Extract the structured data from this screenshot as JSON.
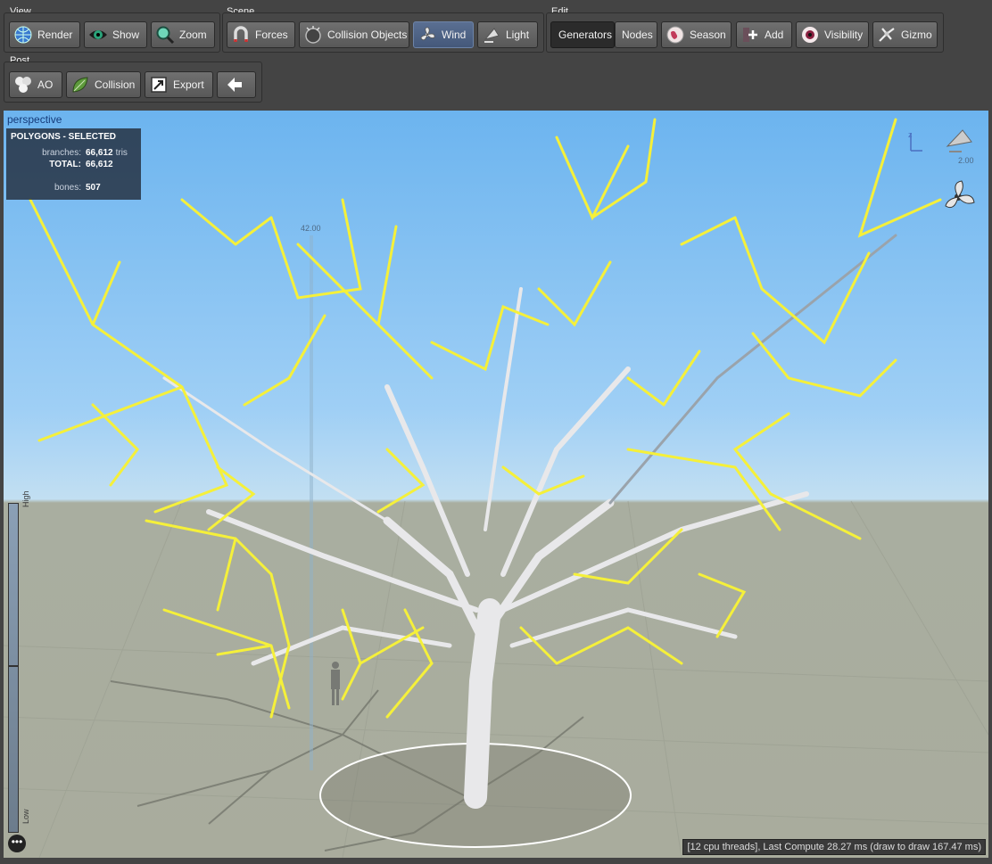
{
  "toolbar": {
    "view": {
      "label": "View",
      "buttons": [
        {
          "label": "Render",
          "icon": "globe-icon"
        },
        {
          "label": "Show",
          "icon": "eye-icon"
        },
        {
          "label": "Zoom",
          "icon": "magnifier-icon"
        }
      ]
    },
    "scene": {
      "label": "Scene",
      "buttons": [
        {
          "label": "Forces",
          "icon": "magnet-icon"
        },
        {
          "label": "Collision Objects",
          "icon": "collision-sphere-icon"
        },
        {
          "label": "Wind",
          "icon": "fan-icon"
        },
        {
          "label": "Light",
          "icon": "lamp-icon"
        }
      ]
    },
    "edit": {
      "label": "Edit",
      "buttons": [
        {
          "label": "Generators"
        },
        {
          "label": "Nodes"
        },
        {
          "label": "Season",
          "icon": "season-globe-icon"
        },
        {
          "label": "Add",
          "icon": "add-icon"
        },
        {
          "label": "Visibility",
          "icon": "eyeball-icon"
        },
        {
          "label": "Gizmo",
          "icon": "gizmo-icon"
        }
      ]
    },
    "post": {
      "label": "Post",
      "buttons": [
        {
          "label": "AO",
          "icon": "spheres-icon"
        },
        {
          "label": "Collision",
          "icon": "leaf-icon"
        },
        {
          "label": "Export",
          "icon": "export-icon"
        },
        {
          "label": "",
          "icon": "arrow-left-icon"
        }
      ]
    }
  },
  "viewport": {
    "title": "perspective",
    "stats": {
      "header": "POLYGONS - SELECTED",
      "rows": [
        {
          "key": "branches:",
          "value": "66,612",
          "unit": "tris"
        },
        {
          "key": "TOTAL:",
          "value": "66,612",
          "unit": ""
        },
        {
          "key": "bones:",
          "value": "507",
          "unit": ""
        }
      ]
    },
    "measure_label": "42.00",
    "zoom_label": "2.00",
    "axis_label": "z",
    "lod_high": "High",
    "lod_low": "Low",
    "more_label": "•••",
    "status": "[12 cpu threads], Last Compute 28.27 ms (draw to draw 167.47 ms)"
  },
  "colors": {
    "active": "#4f6488",
    "highlight": "#f5f03a",
    "sky": "#8cc4f2",
    "ground": "#aaad9e"
  }
}
